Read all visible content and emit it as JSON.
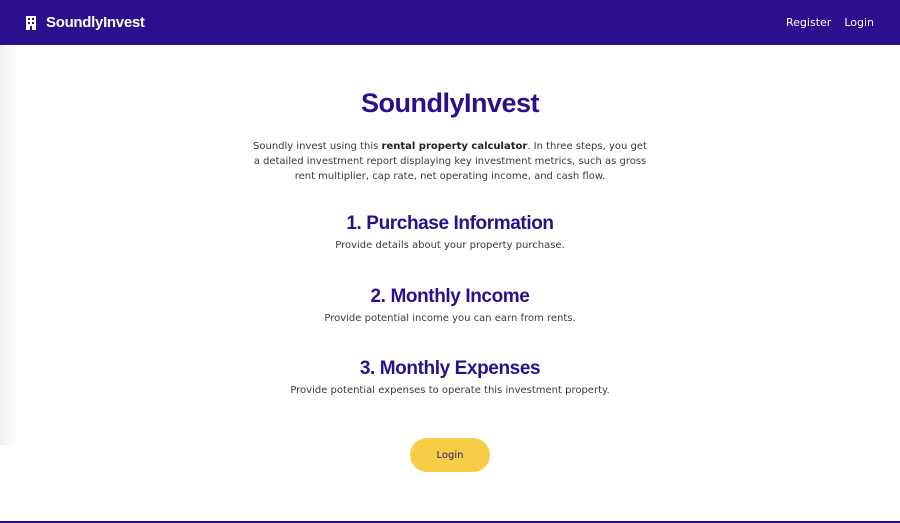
{
  "colors": {
    "brand": "#2c0f8c",
    "accent": "#f6ce45",
    "text": "#3a3a3a"
  },
  "navbar": {
    "brand_icon": "building-icon",
    "brand_name": "SoundlyInvest",
    "links": [
      "Register",
      "Login"
    ]
  },
  "hero": {
    "title": "SoundlyInvest",
    "intro_before": "Soundly invest using this ",
    "intro_bold": "rental property calculator",
    "intro_after": ". In three steps, you get a detailed investment report displaying key investment metrics, such as gross rent multiplier, cap rate, net operating income, and cash flow."
  },
  "steps": [
    {
      "title": "1. Purchase Information",
      "description": "Provide details about your property purchase."
    },
    {
      "title": "2. Monthly Income",
      "description": "Provide potential income you can earn from rents."
    },
    {
      "title": "3. Monthly Expenses",
      "description": "Provide potential expenses to operate this investment property."
    }
  ],
  "cta": {
    "login_label": "Login"
  }
}
